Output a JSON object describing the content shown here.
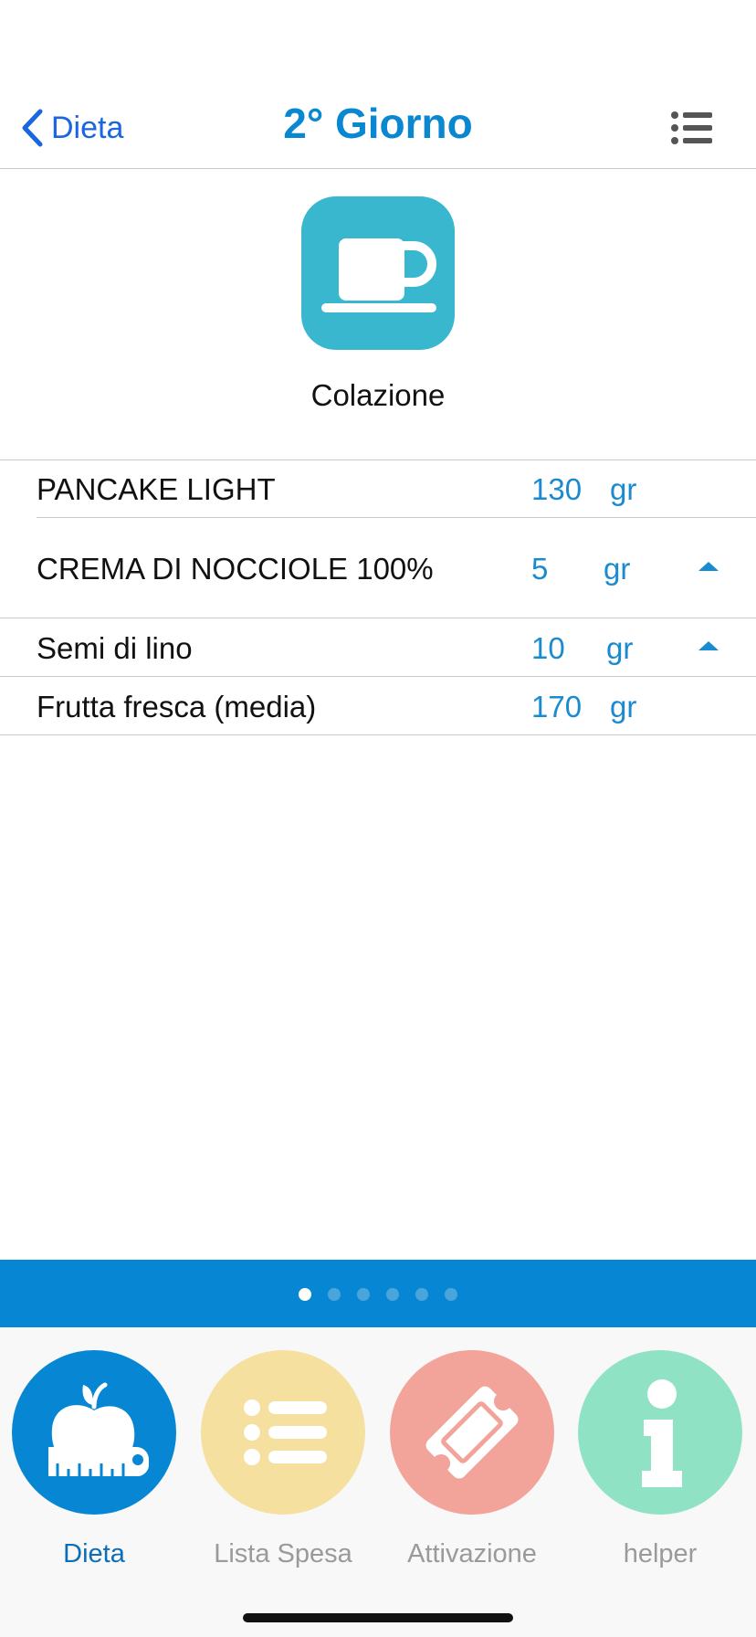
{
  "header": {
    "back_label": "Dieta",
    "title": "2° Giorno",
    "menu_icon": "list-icon"
  },
  "meal": {
    "icon": "coffee-cup-icon",
    "icon_color": "#38b7cf",
    "label": "Colazione"
  },
  "foods": [
    {
      "name": "PANCAKE LIGHT",
      "qty": "130",
      "unit": "gr",
      "has_arrow": false
    },
    {
      "name": "CREMA DI NOCCIOLE 100%",
      "qty": "5",
      "unit": "gr",
      "has_arrow": true
    },
    {
      "name": "Semi di lino",
      "qty": "10",
      "unit": "gr",
      "has_arrow": true
    },
    {
      "name": "Frutta fresca (media)",
      "qty": "170",
      "unit": "gr",
      "has_arrow": false
    }
  ],
  "pager": {
    "count": 6,
    "active_index": 0,
    "bar_color": "#0787d3"
  },
  "tabs": [
    {
      "label": "Dieta",
      "icon": "apple-measuring-tape-icon",
      "color": "#0787d3",
      "active": true
    },
    {
      "label": "Lista Spesa",
      "icon": "list-icon",
      "color": "#f6e0a0",
      "active": false
    },
    {
      "label": "Attivazione",
      "icon": "ticket-icon",
      "color": "#f2a39a",
      "active": false
    },
    {
      "label": "helper",
      "icon": "info-icon",
      "color": "#90e2c4",
      "active": false
    }
  ]
}
